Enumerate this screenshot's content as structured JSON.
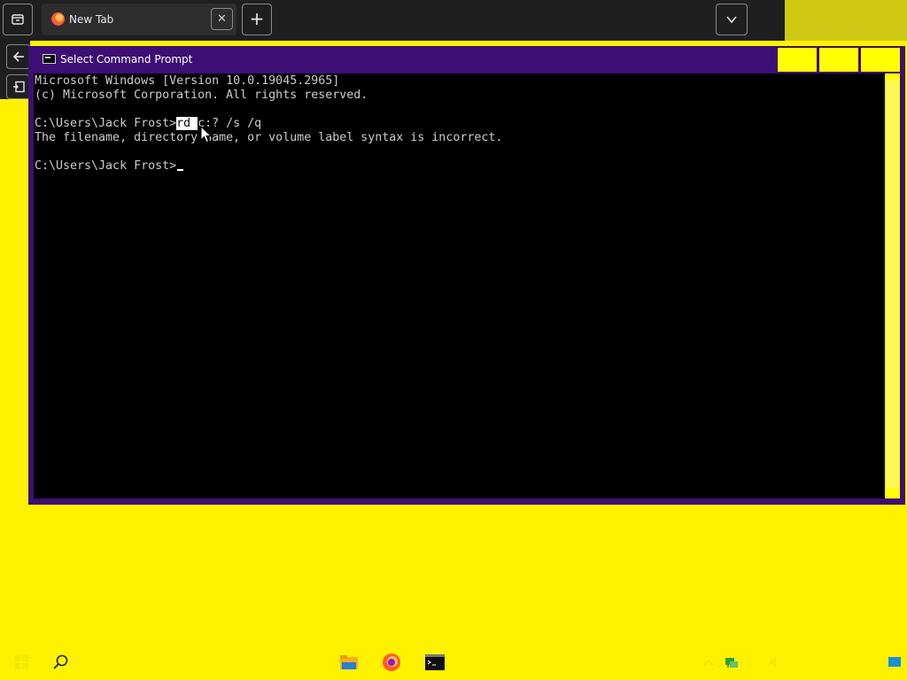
{
  "browser": {
    "tab": {
      "title": "New Tab"
    },
    "new_tab_symbol": "+",
    "tab_close_symbol": "✕"
  },
  "cmd": {
    "title": "Select Command Prompt",
    "lines": {
      "version": "Microsoft Windows [Version 10.0.19045.2965]",
      "copyright": "(c) Microsoft Corporation. All rights reserved.",
      "command_prompt": "C:\\Users\\Jack Frost>",
      "command_selected": "rd ",
      "command_rest": "c:? /s /q",
      "error": "The filename, directory name, or volume label syntax is incorrect.",
      "current_prompt": "C:\\Users\\Jack Frost>"
    }
  },
  "colors": {
    "desktop": "#fff200",
    "titlebar": "#3d0e74",
    "console": "#000000",
    "console_text": "#cccccc"
  },
  "icons": {
    "tab_list": "tab-list-icon",
    "back": "back-arrow-icon",
    "sidebar": "sidebar-icon",
    "search": "search-icon",
    "files": "file-explorer-icon",
    "firefox": "firefox-icon",
    "cmd": "command-prompt-icon"
  }
}
